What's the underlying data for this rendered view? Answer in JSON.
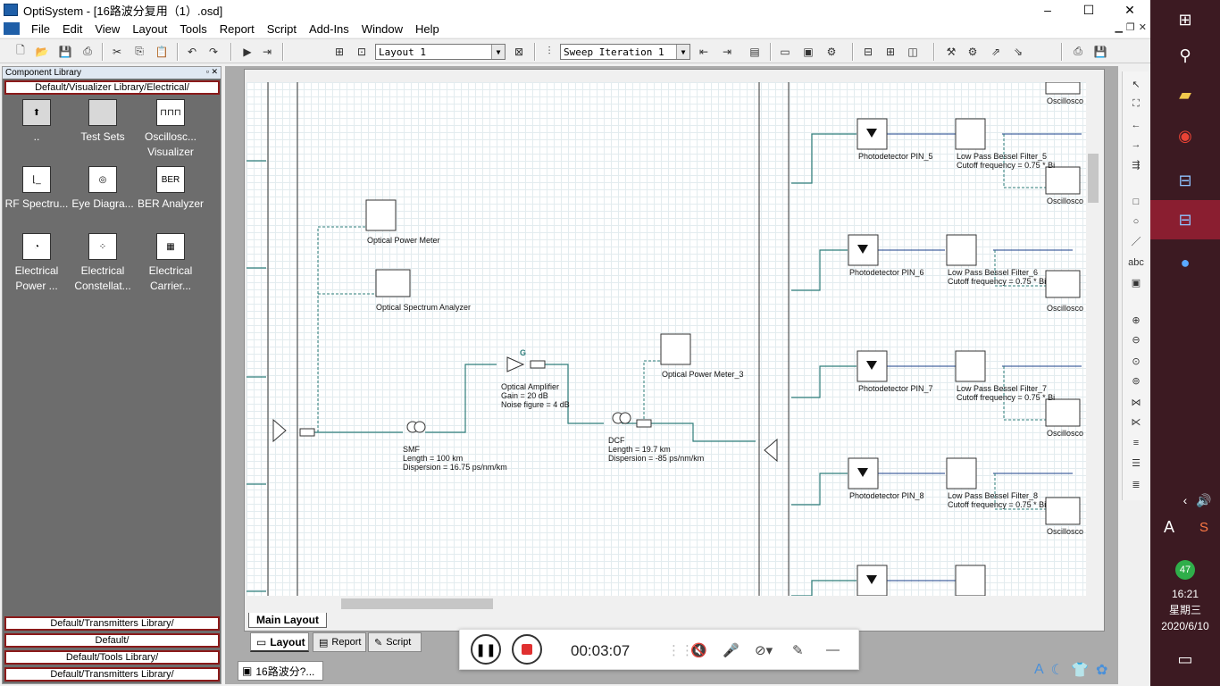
{
  "window": {
    "title": "OptiSystem - [16路波分复用（1）.osd]",
    "min": "–",
    "max": "☐",
    "close": "✕"
  },
  "menu": [
    "File",
    "Edit",
    "View",
    "Layout",
    "Tools",
    "Report",
    "Script",
    "Add-Ins",
    "Window",
    "Help"
  ],
  "toolbar": {
    "layout_combo": "Layout 1",
    "sweep_combo": "Sweep Iteration  1"
  },
  "library": {
    "title": "Component Library",
    "path": "Default/Visualizer Library/Electrical/",
    "items": [
      {
        "label": "..",
        "icon": "up-folder-icon"
      },
      {
        "label": "Test Sets",
        "icon": "folder-icon"
      },
      {
        "label": "Oscillosc... Visualizer",
        "icon": "oscilloscope-icon"
      },
      {
        "label": "RF Spectru...",
        "icon": "rf-spectrum-icon"
      },
      {
        "label": "Eye Diagra...",
        "icon": "eye-diagram-icon"
      },
      {
        "label": "BER Analyzer",
        "icon": "ber-analyzer-icon"
      },
      {
        "label": "Electrical Power ...",
        "icon": "power-meter-icon"
      },
      {
        "label": "Electrical Constellat...",
        "icon": "constellation-icon"
      },
      {
        "label": "Electrical Carrier...",
        "icon": "carrier-icon"
      }
    ],
    "bottom_folders": [
      "Default/Transmitters Library/",
      "Default/",
      "Default/Tools Library/",
      "Default/Transmitters Library/"
    ]
  },
  "canvas": {
    "components": {
      "opm1": "Optical Power Meter",
      "osa": "Optical Spectrum Analyzer",
      "amp_g": "G",
      "amp": [
        "Optical Amplifier",
        "Gain = 20  dB",
        "Noise figure = 4  dB"
      ],
      "opm3": "Optical Power Meter_3",
      "smf": [
        "SMF",
        "Length = 100  km",
        "Dispersion = 16.75  ps/nm/km"
      ],
      "dcf": [
        "DCF",
        "Length = 19.7 km",
        "Dispersion = -85  ps/nm/km"
      ],
      "pd5": "Photodetector PIN_5",
      "lp5": [
        "Low Pass Bessel Filter_5",
        "Cutoff frequency = 0.75 * Bi"
      ],
      "pd6": "Photodetector PIN_6",
      "lp6": [
        "Low Pass Bessel Filter_6",
        "Cutoff frequency = 0.75 * Bi"
      ],
      "pd7": "Photodetector PIN_7",
      "lp7": [
        "Low Pass Bessel Filter_7",
        "Cutoff frequency = 0.75 * Bi"
      ],
      "pd8": "Photodetector PIN_8",
      "lp8": [
        "Low Pass Bessel Filter_8",
        "Cutoff frequency = 0.75 * Bi"
      ],
      "osc": "Oscillosco"
    }
  },
  "tabs": {
    "main_layout": "Main Layout",
    "bottom": [
      "Layout",
      "Report",
      "Script"
    ],
    "doc": "16路波分?..."
  },
  "recorder": {
    "time": "00:03:07"
  },
  "tray": {
    "badge": "47",
    "ime": "A",
    "time": "16:21",
    "weekday": "星期三",
    "date": "2020/6/10"
  }
}
